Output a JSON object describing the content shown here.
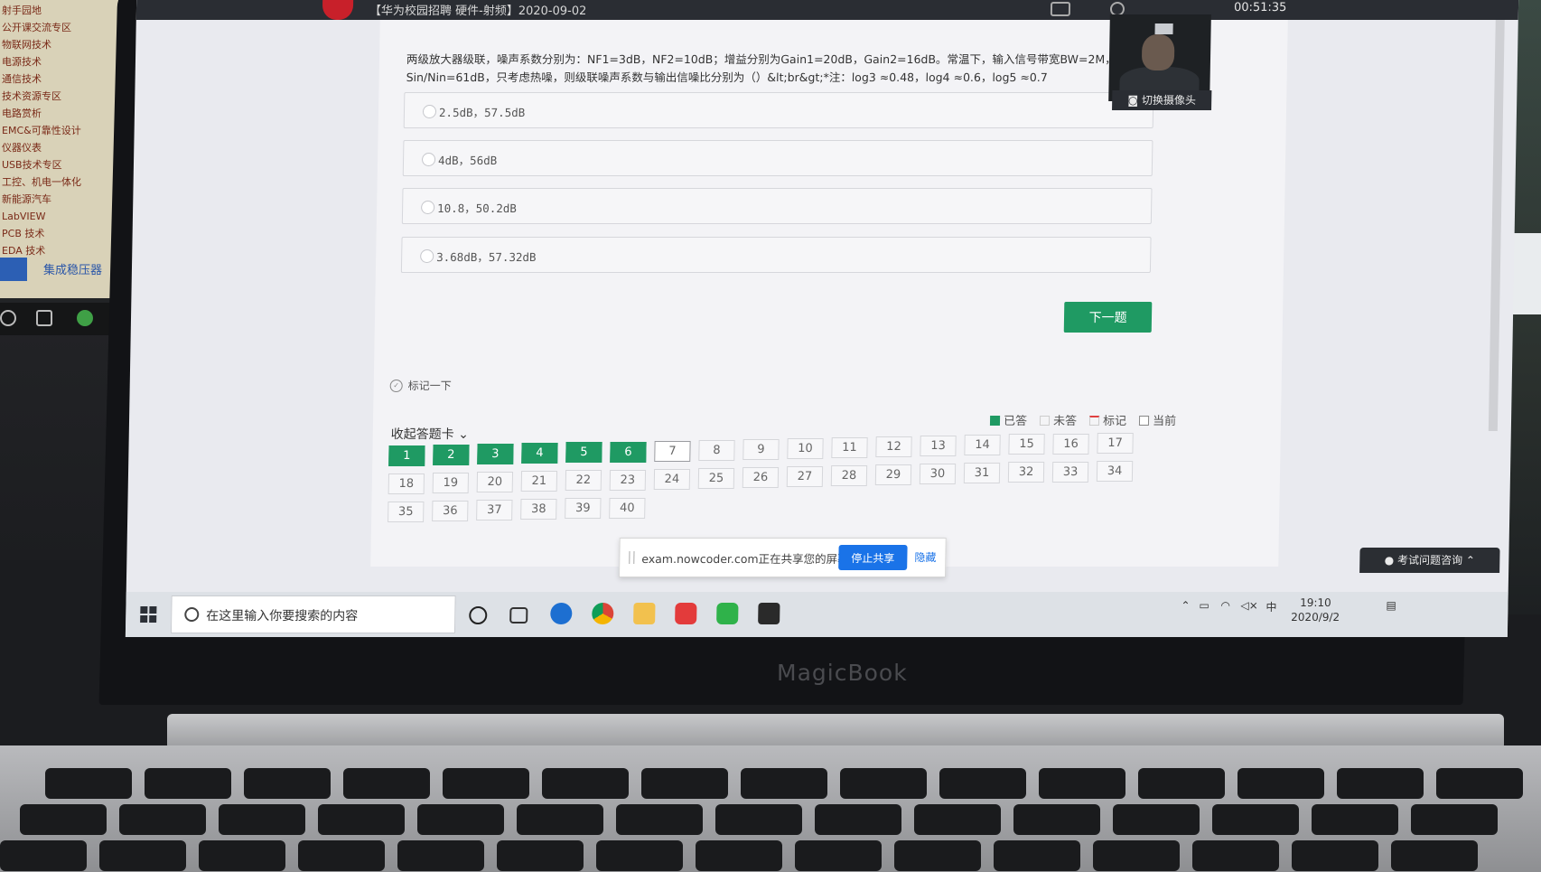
{
  "exam": {
    "window_title": "【华为校园招聘 硬件-射频】2020-09-02",
    "timer": "00:51:35",
    "question_text": "两级放大器级联，噪声系数分别为：NF1=3dB，NF2=10dB；增益分别为Gain1=20dB，Gain2=16dB。常温下，输入信号带宽BW=2M，功 Sin/Nin=61dB，只考虑热噪，则级联噪声系数与输出信噪比分别为（）&lt;br&gt;*注：log3 ≈0.48，log4 ≈0.6，log5 ≈0.7",
    "options": [
      "2.5dB，57.5dB",
      "4dB，56dB",
      "10.8，50.2dB",
      "3.68dB，57.32dB"
    ],
    "next_button": "下一题",
    "mark_label": "标记一下",
    "collapse_label": "收起答题卡",
    "legend": {
      "answered": "已答",
      "unanswered": "未答",
      "marked": "标记",
      "current": "当前"
    },
    "answer_card": {
      "answered": [
        1,
        2,
        3,
        4,
        5,
        6
      ],
      "current": 7,
      "numbers": [
        1,
        2,
        3,
        4,
        5,
        6,
        7,
        8,
        9,
        10,
        11,
        12,
        13,
        14,
        15,
        16,
        17,
        18,
        19,
        20,
        21,
        22,
        23,
        24,
        25,
        26,
        27,
        28,
        29,
        30,
        31,
        32,
        33,
        34,
        35,
        36,
        37,
        38,
        39,
        40
      ]
    },
    "camera_label": "切换摄像头",
    "help_button": "考试问题咨询"
  },
  "share_bar": {
    "message": "exam.nowcoder.com正在共享您的屏幕。",
    "stop": "停止共享",
    "hide": "隐藏"
  },
  "taskbar": {
    "search_placeholder": "在这里输入你要搜索的内容",
    "time": "19:10",
    "date": "2020/9/2",
    "ime": "中"
  },
  "laptop_brand": "MagicBook",
  "background_monitor": {
    "list_items": [
      "射手园地",
      "公开课交流专区",
      "物联网技术",
      "电源技术",
      "通信技术",
      "技术资源专区",
      "电路赏析",
      "EMC&可靠性设计",
      "仪器仪表",
      "USB技术专区",
      "工控、机电一体化",
      "新能源汽车",
      "LabVIEW",
      "PCB 技术",
      "EDA 技术"
    ],
    "tab_label": "集成稳压器"
  },
  "colors": {
    "accent": "#1f9a63",
    "share_blue": "#1a73e8"
  }
}
